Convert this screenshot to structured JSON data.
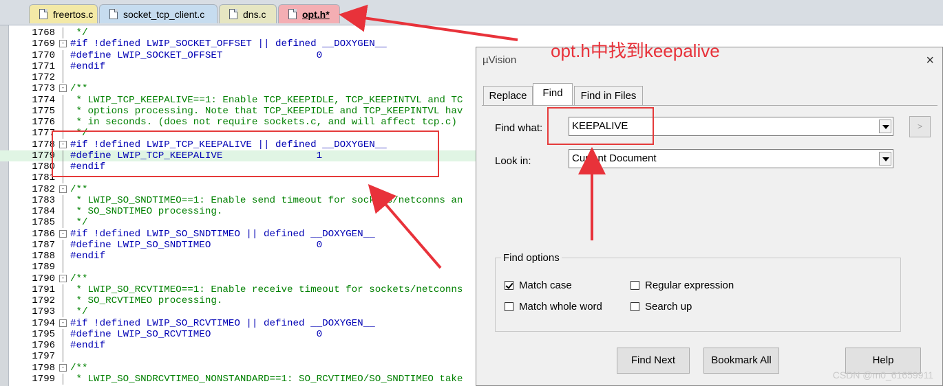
{
  "tabs": [
    {
      "label": "freertos.c",
      "active": false,
      "bg": "#f3e9a6"
    },
    {
      "label": "socket_tcp_client.c",
      "active": false,
      "bg": "#c6dcef"
    },
    {
      "label": "dns.c",
      "active": false,
      "bg": "#e6e6c2"
    },
    {
      "label": "opt.h*",
      "active": true,
      "bg": "#f4aeb3"
    }
  ],
  "code": [
    {
      "n": "1768",
      "fold": "",
      "kind": "com",
      "text": " */"
    },
    {
      "n": "1769",
      "fold": "-",
      "kind": "pre",
      "text": "#if !defined LWIP_SOCKET_OFFSET || defined __DOXYGEN__"
    },
    {
      "n": "1770",
      "fold": "",
      "kind": "pre",
      "text": "#define LWIP_SOCKET_OFFSET                0"
    },
    {
      "n": "1771",
      "fold": "",
      "kind": "pre",
      "text": "#endif"
    },
    {
      "n": "1772",
      "fold": "",
      "kind": "def",
      "text": ""
    },
    {
      "n": "1773",
      "fold": "-",
      "kind": "com",
      "text": "/**"
    },
    {
      "n": "1774",
      "fold": "",
      "kind": "com",
      "text": " * LWIP_TCP_KEEPALIVE==1: Enable TCP_KEEPIDLE, TCP_KEEPINTVL and TC"
    },
    {
      "n": "1775",
      "fold": "",
      "kind": "com",
      "text": " * options processing. Note that TCP_KEEPIDLE and TCP_KEEPINTVL hav"
    },
    {
      "n": "1776",
      "fold": "",
      "kind": "com",
      "text": " * in seconds. (does not require sockets.c, and will affect tcp.c)"
    },
    {
      "n": "1777",
      "fold": "",
      "kind": "com",
      "text": " */"
    },
    {
      "n": "1778",
      "fold": "-",
      "kind": "pre",
      "text": "#if !defined LWIP_TCP_KEEPALIVE || defined __DOXYGEN__"
    },
    {
      "n": "1779",
      "fold": "",
      "kind": "pre",
      "text": "#define LWIP_TCP_KEEPALIVE                1",
      "highlight": true
    },
    {
      "n": "1780",
      "fold": "",
      "kind": "pre",
      "text": "#endif"
    },
    {
      "n": "1781",
      "fold": "",
      "kind": "def",
      "text": ""
    },
    {
      "n": "1782",
      "fold": "-",
      "kind": "com",
      "text": "/**"
    },
    {
      "n": "1783",
      "fold": "",
      "kind": "com",
      "text": " * LWIP_SO_SNDTIMEO==1: Enable send timeout for sockets/netconns an"
    },
    {
      "n": "1784",
      "fold": "",
      "kind": "com",
      "text": " * SO_SNDTIMEO processing."
    },
    {
      "n": "1785",
      "fold": "",
      "kind": "com",
      "text": " */"
    },
    {
      "n": "1786",
      "fold": "-",
      "kind": "pre",
      "text": "#if !defined LWIP_SO_SNDTIMEO || defined __DOXYGEN__"
    },
    {
      "n": "1787",
      "fold": "",
      "kind": "pre",
      "text": "#define LWIP_SO_SNDTIMEO                  0"
    },
    {
      "n": "1788",
      "fold": "",
      "kind": "pre",
      "text": "#endif"
    },
    {
      "n": "1789",
      "fold": "",
      "kind": "def",
      "text": ""
    },
    {
      "n": "1790",
      "fold": "-",
      "kind": "com",
      "text": "/**"
    },
    {
      "n": "1791",
      "fold": "",
      "kind": "com",
      "text": " * LWIP_SO_RCVTIMEO==1: Enable receive timeout for sockets/netconns"
    },
    {
      "n": "1792",
      "fold": "",
      "kind": "com",
      "text": " * SO_RCVTIMEO processing."
    },
    {
      "n": "1793",
      "fold": "",
      "kind": "com",
      "text": " */"
    },
    {
      "n": "1794",
      "fold": "-",
      "kind": "pre",
      "text": "#if !defined LWIP_SO_RCVTIMEO || defined __DOXYGEN__"
    },
    {
      "n": "1795",
      "fold": "",
      "kind": "pre",
      "text": "#define LWIP_SO_RCVTIMEO                  0"
    },
    {
      "n": "1796",
      "fold": "",
      "kind": "pre",
      "text": "#endif"
    },
    {
      "n": "1797",
      "fold": "",
      "kind": "def",
      "text": ""
    },
    {
      "n": "1798",
      "fold": "-",
      "kind": "com",
      "text": "/**"
    },
    {
      "n": "1799",
      "fold": "",
      "kind": "com",
      "text": " * LWIP_SO_SNDRCVTIMEO_NONSTANDARD==1: SO_RCVTIMEO/SO_SNDTIMEO take"
    }
  ],
  "dialog": {
    "title": "µVision",
    "close_icon": "×",
    "tabs": [
      "Replace",
      "Find",
      "Find in Files"
    ],
    "selected_tab": "Find",
    "find_what_label": "Find what:",
    "find_what_value": "KEEPALIVE",
    "look_in_label": "Look in:",
    "look_in_value": "Current Document",
    "more_button": ">",
    "options_title": "Find options",
    "options": [
      {
        "label": "Match case",
        "checked": true
      },
      {
        "label": "Regular expression",
        "checked": false
      },
      {
        "label": "Match whole word",
        "checked": false
      },
      {
        "label": "Search up",
        "checked": false
      }
    ],
    "buttons": {
      "find_next": "Find Next",
      "bookmark_all": "Bookmark All",
      "help": "Help"
    }
  },
  "annotation": {
    "text": "opt.h中找到keepalive",
    "color": "#e8323a"
  },
  "watermark": "CSDN @m0_61659911"
}
